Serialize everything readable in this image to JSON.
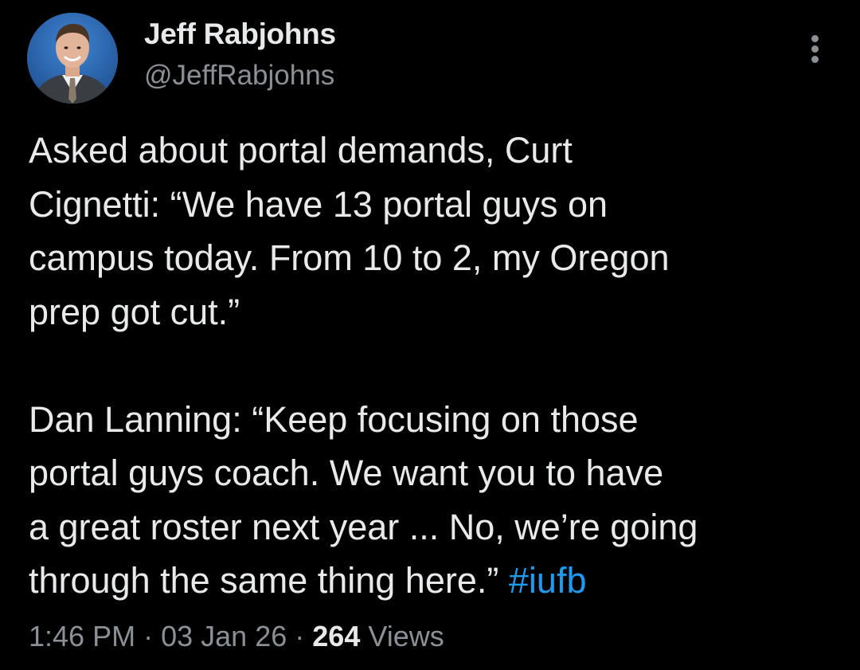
{
  "author": {
    "name": "Jeff Rabjohns",
    "handle": "@JeffRabjohns",
    "avatar_icon": "profile-photo"
  },
  "menu": {
    "icon": "more-options-icon"
  },
  "tweet": {
    "lines": [
      "Asked about portal demands, Curt",
      "Cignetti: “We have 13 portal guys on",
      "campus today. From 10 to 2, my Oregon",
      "prep got cut.”",
      "Dan Lanning: “Keep focusing on those",
      "portal guys coach. We want you to have",
      "a great roster next year ... No, we’re going",
      "through the same thing here.”"
    ],
    "hashtag": "#iufb"
  },
  "meta": {
    "time": "1:46 PM",
    "date": "03 Jan 26",
    "separator": "·",
    "views_count": "264",
    "views_label": "Views"
  },
  "colors": {
    "background": "#000000",
    "text_primary": "#e7e9ea",
    "text_secondary": "#8b9096",
    "link": "#1d9bf0"
  }
}
